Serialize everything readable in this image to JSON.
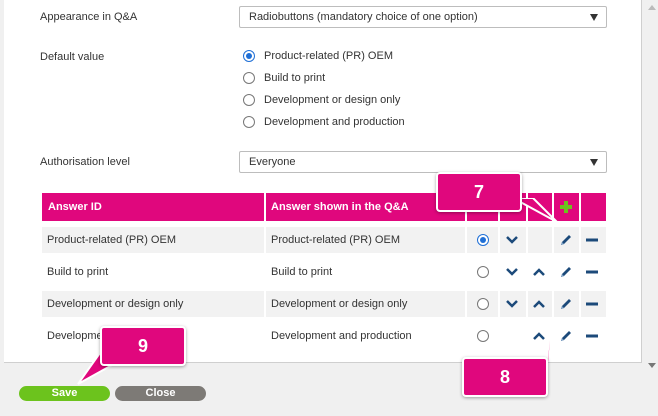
{
  "form": {
    "appearance_label": "Appearance in Q&A",
    "appearance_value": "Radiobuttons (mandatory choice of one option)",
    "default_label": "Default value",
    "default_options": [
      {
        "label": "Product-related (PR) OEM",
        "checked": true
      },
      {
        "label": "Build to print",
        "checked": false
      },
      {
        "label": "Development or design only",
        "checked": false
      },
      {
        "label": "Development and production",
        "checked": false
      }
    ],
    "authorisation_label": "Authorisation level",
    "authorisation_value": "Everyone"
  },
  "table": {
    "headers": {
      "answer_id": "Answer ID",
      "answer_shown": "Answer shown in the Q&A"
    },
    "rows": [
      {
        "id": "Product-related (PR) OEM",
        "shown": "Product-related (PR) OEM",
        "selected": true,
        "down": true,
        "up": false
      },
      {
        "id": "Build to print",
        "shown": "Build to print",
        "selected": false,
        "down": true,
        "up": true
      },
      {
        "id": "Development or design only",
        "shown": "Development or design only",
        "selected": false,
        "down": true,
        "up": true
      },
      {
        "id": "Development and production",
        "shown": "Development and production",
        "selected": false,
        "down": false,
        "up": true
      }
    ],
    "row_partial_label": "Developme"
  },
  "callouts": {
    "seven": "7",
    "eight": "8",
    "nine": "9"
  },
  "buttons": {
    "save": "Save",
    "close": "Close"
  },
  "colors": {
    "accent": "#e0077d",
    "save": "#6cc31d",
    "close": "#7d7a76",
    "icon": "#1c4a7a",
    "plus": "#6cc31d"
  },
  "icons": [
    "chevron-down-icon",
    "chevron-up-icon",
    "pencil-icon",
    "minus-icon",
    "plus-icon",
    "radio-icon"
  ]
}
